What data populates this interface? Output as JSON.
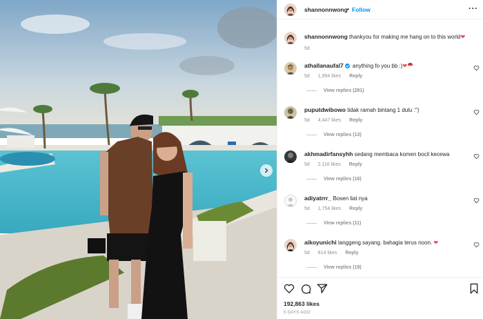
{
  "post": {
    "author": "shannonnwong",
    "separator": "•",
    "follow_label": "Follow",
    "more_label": "···",
    "caption": {
      "username": "shannonnwong",
      "text": "thankyou for making me hang on to this world",
      "emoji": "❤",
      "time": "5d"
    },
    "likes": "192,863 likes",
    "posted_ago": "5 DAYS AGO"
  },
  "comments": [
    {
      "username": "athallanaufal7",
      "verified": true,
      "text": "anything fo you bb :)",
      "emoji": "❤",
      "time": "5d",
      "likes": "1,994 likes",
      "reply": "Reply",
      "view_replies": "View replies (281)"
    },
    {
      "username": "puputdwibowo",
      "verified": false,
      "text": "tidak ramah bintang 1 dulu :\")",
      "emoji": "",
      "time": "5d",
      "likes": "4,447 likes",
      "reply": "Reply",
      "view_replies": "View replies (13)"
    },
    {
      "username": "akhmadirfansyhh",
      "verified": false,
      "text": "sedang membaca komen bocil kecewa",
      "emoji": "",
      "time": "5d",
      "likes": "2,116 likes",
      "reply": "Reply",
      "view_replies": "View replies (16)"
    },
    {
      "username": "adiyatrrr_",
      "verified": false,
      "text": "Bosen liat nya",
      "emoji": "",
      "time": "5d",
      "likes": "1,754 likes",
      "reply": "Reply",
      "view_replies": "View replies (11)"
    },
    {
      "username": "aikoyunichi",
      "verified": false,
      "text": "langgeng sayang. bahagia terus noon.",
      "emoji": "❤",
      "time": "5d",
      "likes": "814 likes",
      "reply": "Reply",
      "view_replies": "View replies (19)"
    }
  ],
  "icons": {
    "like": "heart-icon",
    "comment": "comment-icon",
    "share": "share-icon",
    "save": "bookmark-icon",
    "next": "chevron-right-icon"
  }
}
